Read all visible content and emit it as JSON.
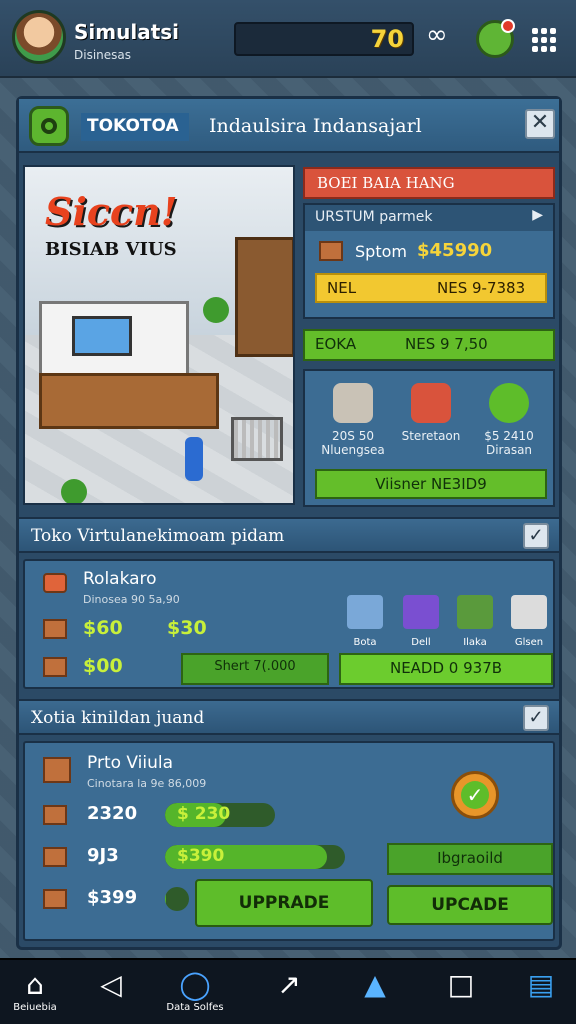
{
  "header": {
    "title": "Simulatsi",
    "subtitle": "Disinesas",
    "coins": "70"
  },
  "modal": {
    "tag": "TOKOTOA",
    "subtitle": "Indaulsira Indansajarl",
    "scene": {
      "title": "Siccn!",
      "subtitle": "BISIAB VIUS"
    },
    "offer": {
      "banner": "BOEI BAIA HANG",
      "head": "URSTUM parmek",
      "item_label": "Sptom",
      "item_price": "$45990",
      "yellow_label": "NEL",
      "yellow_value": "NES 9-7383",
      "green_label": "EOKA",
      "green_value": "NES 9 7,50"
    },
    "stats": [
      {
        "value": "20S 50",
        "label": "Nluengsea",
        "color": "#c9c2b6"
      },
      {
        "value": "Steretaon",
        "label": "",
        "color": "#d9533c"
      },
      {
        "value": "$5 2410",
        "label": "Dirasan",
        "color": "#5ebd2a"
      }
    ],
    "stats_button": "Viisner NE3ID9"
  },
  "section1": {
    "header": "Toko Virtulanekimoam pidam",
    "title": "Rolakaro",
    "sub": "Dinosea 90 5a,90",
    "row1_a": "$60",
    "row1_b": "$30",
    "row2_a": "$00",
    "bar_text": "Shert 7(.000",
    "green_button": "NEADD 0 937B",
    "items": [
      {
        "label": "Bota",
        "color": "#7aa8d8"
      },
      {
        "label": "Dell",
        "color": "#7a4fd1"
      },
      {
        "label": "Ilaka",
        "color": "#5a9a3c"
      },
      {
        "label": "Glsen",
        "color": "#dcdcdc"
      }
    ]
  },
  "section2": {
    "header": "Xotia kinildan juand",
    "title": "Prto Viiula",
    "sub": "Cinotara la 9e 86,009",
    "row1_value": "2320",
    "row1_bar": "$ 230",
    "row1_fill": 0.55,
    "row2_value": "9J3",
    "row2_bar": "$390",
    "row2_fill": 0.9,
    "row3_value": "$399",
    "row3_fill": 0.06,
    "upgraded_button": "Ibgraoild",
    "upprade_button": "UPPRADE",
    "update_button": "UPCADE"
  },
  "nav": [
    {
      "icon": "home",
      "label": "Beiuebia"
    },
    {
      "icon": "back",
      "label": ""
    },
    {
      "icon": "search",
      "label": "Data Solfes"
    },
    {
      "icon": "share",
      "label": ""
    },
    {
      "icon": "boat",
      "label": ""
    },
    {
      "icon": "square",
      "label": ""
    },
    {
      "icon": "briefcase",
      "label": ""
    }
  ]
}
